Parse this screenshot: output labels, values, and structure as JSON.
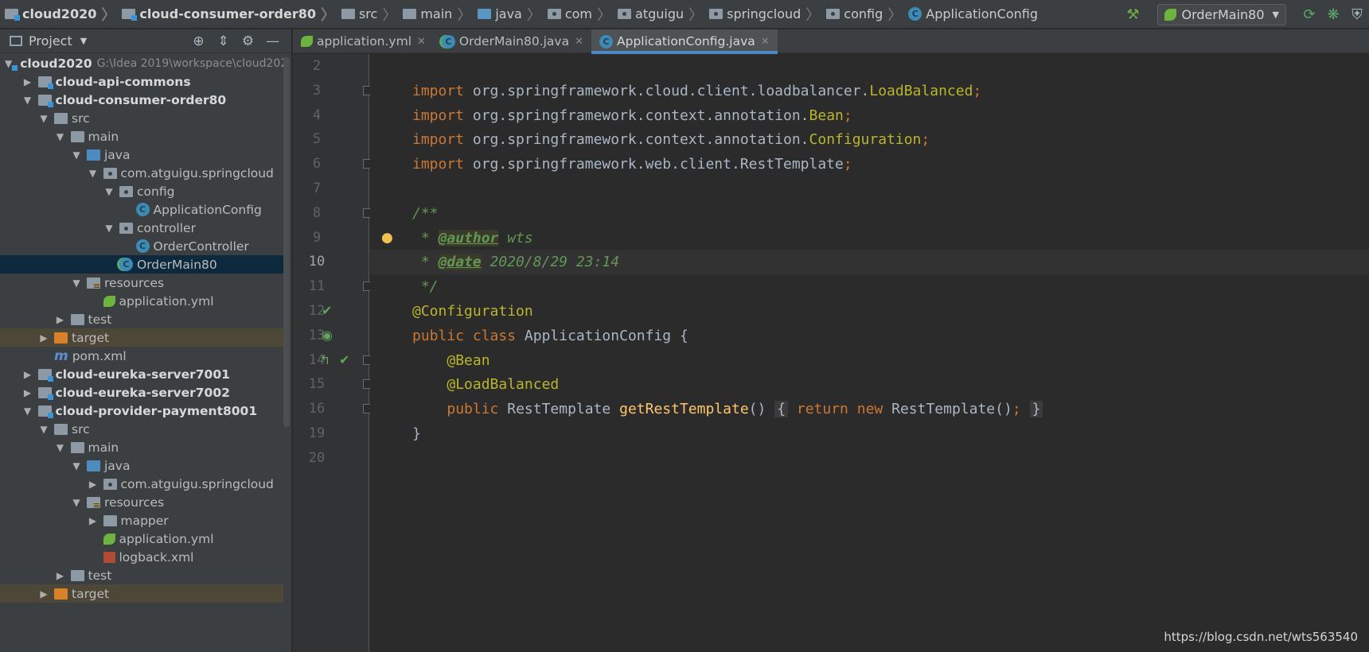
{
  "breadcrumbs": [
    {
      "label": "cloud2020",
      "icon": "module-folder-icon",
      "bold": true
    },
    {
      "label": "cloud-consumer-order80",
      "icon": "module-folder-icon",
      "bold": true
    },
    {
      "label": "src",
      "icon": "folder-icon"
    },
    {
      "label": "main",
      "icon": "folder-icon"
    },
    {
      "label": "java",
      "icon": "source-folder-icon"
    },
    {
      "label": "com",
      "icon": "package-icon"
    },
    {
      "label": "atguigu",
      "icon": "package-icon"
    },
    {
      "label": "springcloud",
      "icon": "package-icon"
    },
    {
      "label": "config",
      "icon": "package-icon"
    },
    {
      "label": "ApplicationConfig",
      "icon": "class-icon"
    }
  ],
  "toolbar": {
    "run_config": "OrderMain80",
    "icons": [
      "build-hammer-icon",
      "rerun-icon",
      "debug-icon",
      "coverage-icon"
    ]
  },
  "project_panel": {
    "title": "Project",
    "icons": [
      "locate-icon",
      "collapse-icon",
      "settings-icon",
      "minimize-icon"
    ]
  },
  "tree": [
    {
      "label": "cloud2020",
      "path": "G:\\Idea 2019\\workspace\\cloud202",
      "depth": 0,
      "expanded": true,
      "icon": "mod",
      "bold": true
    },
    {
      "label": "cloud-api-commons",
      "depth": 1,
      "expanded": false,
      "icon": "mod",
      "bold": true
    },
    {
      "label": "cloud-consumer-order80",
      "depth": 1,
      "expanded": true,
      "icon": "mod",
      "bold": true
    },
    {
      "label": "src",
      "depth": 2,
      "expanded": true,
      "icon": "folder"
    },
    {
      "label": "main",
      "depth": 3,
      "expanded": true,
      "icon": "folder"
    },
    {
      "label": "java",
      "depth": 4,
      "expanded": true,
      "icon": "src"
    },
    {
      "label": "com.atguigu.springcloud",
      "depth": 5,
      "expanded": true,
      "icon": "pkg"
    },
    {
      "label": "config",
      "depth": 6,
      "expanded": true,
      "icon": "pkg"
    },
    {
      "label": "ApplicationConfig",
      "depth": 7,
      "icon": "class"
    },
    {
      "label": "controller",
      "depth": 6,
      "expanded": true,
      "icon": "pkg"
    },
    {
      "label": "OrderController",
      "depth": 7,
      "icon": "class"
    },
    {
      "label": "OrderMain80",
      "depth": 6,
      "icon": "class-run",
      "selected": true
    },
    {
      "label": "resources",
      "depth": 4,
      "expanded": true,
      "icon": "res"
    },
    {
      "label": "application.yml",
      "depth": 5,
      "icon": "yml"
    },
    {
      "label": "test",
      "depth": 3,
      "expanded": false,
      "icon": "folder"
    },
    {
      "label": "target",
      "depth": 2,
      "expanded": false,
      "icon": "target",
      "excluded": true
    },
    {
      "label": "pom.xml",
      "depth": 2,
      "icon": "maven"
    },
    {
      "label": "cloud-eureka-server7001",
      "depth": 1,
      "expanded": false,
      "icon": "mod",
      "bold": true
    },
    {
      "label": "cloud-eureka-server7002",
      "depth": 1,
      "expanded": false,
      "icon": "mod",
      "bold": true
    },
    {
      "label": "cloud-provider-payment8001",
      "depth": 1,
      "expanded": true,
      "icon": "mod",
      "bold": true
    },
    {
      "label": "src",
      "depth": 2,
      "expanded": true,
      "icon": "folder"
    },
    {
      "label": "main",
      "depth": 3,
      "expanded": true,
      "icon": "folder"
    },
    {
      "label": "java",
      "depth": 4,
      "expanded": true,
      "icon": "src"
    },
    {
      "label": "com.atguigu.springcloud",
      "depth": 5,
      "expanded": false,
      "icon": "pkg"
    },
    {
      "label": "resources",
      "depth": 4,
      "expanded": true,
      "icon": "res"
    },
    {
      "label": "mapper",
      "depth": 5,
      "expanded": false,
      "icon": "folder"
    },
    {
      "label": "application.yml",
      "depth": 5,
      "icon": "yml"
    },
    {
      "label": "logback.xml",
      "depth": 5,
      "icon": "xml"
    },
    {
      "label": "test",
      "depth": 3,
      "expanded": false,
      "icon": "folder"
    },
    {
      "label": "target",
      "depth": 2,
      "expanded": false,
      "icon": "target",
      "excluded": true
    }
  ],
  "tabs": [
    {
      "label": "application.yml",
      "icon": "yml",
      "active": false
    },
    {
      "label": "OrderMain80.java",
      "icon": "class-run",
      "active": false
    },
    {
      "label": "ApplicationConfig.java",
      "icon": "class",
      "active": true
    }
  ],
  "editor": {
    "current_line": "10",
    "lines": [
      {
        "num": "2",
        "tokens": []
      },
      {
        "num": "3",
        "fold": true,
        "tokens": [
          {
            "t": "import",
            "c": "kw"
          },
          {
            "t": " org.springframework.cloud.client.loadbalancer.",
            "c": "pl"
          },
          {
            "t": "LoadBalanced",
            "c": "cls"
          },
          {
            "t": ";",
            "c": "kw"
          }
        ]
      },
      {
        "num": "4",
        "tokens": [
          {
            "t": "import",
            "c": "kw"
          },
          {
            "t": " org.springframework.context.annotation.",
            "c": "pl"
          },
          {
            "t": "Bean",
            "c": "cls"
          },
          {
            "t": ";",
            "c": "kw"
          }
        ]
      },
      {
        "num": "5",
        "tokens": [
          {
            "t": "import",
            "c": "kw"
          },
          {
            "t": " org.springframework.context.annotation.",
            "c": "pl"
          },
          {
            "t": "Configuration",
            "c": "cls"
          },
          {
            "t": ";",
            "c": "kw"
          }
        ]
      },
      {
        "num": "6",
        "fold": true,
        "tokens": [
          {
            "t": "import",
            "c": "kw"
          },
          {
            "t": " org.springframework.web.client.RestTemplate",
            "c": "pl"
          },
          {
            "t": ";",
            "c": "kw"
          }
        ]
      },
      {
        "num": "7",
        "tokens": []
      },
      {
        "num": "8",
        "fold": true,
        "tokens": [
          {
            "t": "/**",
            "c": "doc"
          }
        ]
      },
      {
        "num": "9",
        "tokens": [
          {
            "t": " * ",
            "c": "doc"
          },
          {
            "t": "@author",
            "c": "tag"
          },
          {
            "t": " wts",
            "c": "doc"
          }
        ]
      },
      {
        "num": "10",
        "tokens": [
          {
            "t": " * ",
            "c": "doc"
          },
          {
            "t": "@date",
            "c": "tag"
          },
          {
            "t": " 2020/8/29 23:14",
            "c": "doc"
          }
        ]
      },
      {
        "num": "11",
        "fold": true,
        "tokens": [
          {
            "t": " */",
            "c": "doc"
          }
        ]
      },
      {
        "num": "12",
        "marks": [
          "bean-check-icon"
        ],
        "tokens": [
          {
            "t": "@Configuration",
            "c": "ann"
          }
        ]
      },
      {
        "num": "13",
        "marks": [
          "spring-bean-icon"
        ],
        "tokens": [
          {
            "t": "public",
            "c": "kw"
          },
          {
            "t": " ",
            "c": "pl"
          },
          {
            "t": "class",
            "c": "kw"
          },
          {
            "t": " ApplicationConfig {",
            "c": "pl"
          }
        ]
      },
      {
        "num": "14",
        "fold": true,
        "marks": [
          "navigate-icon",
          "bean-check-icon"
        ],
        "tokens": [
          {
            "t": "    ",
            "c": "pl"
          },
          {
            "t": "@Bean",
            "c": "ann"
          }
        ]
      },
      {
        "num": "15",
        "fold": true,
        "tokens": [
          {
            "t": "    ",
            "c": "pl"
          },
          {
            "t": "@LoadBalanced",
            "c": "ann"
          }
        ]
      },
      {
        "num": "16",
        "foldplus": true,
        "tokens": [
          {
            "t": "    ",
            "c": "pl"
          },
          {
            "t": "public",
            "c": "kw"
          },
          {
            "t": " RestTemplate ",
            "c": "pl"
          },
          {
            "t": "getRestTemplate",
            "c": "fn"
          },
          {
            "t": "() ",
            "c": "pl"
          },
          {
            "t": "{",
            "c": "brace"
          },
          {
            "t": " ",
            "c": "pl"
          },
          {
            "t": "return",
            "c": "kw"
          },
          {
            "t": " ",
            "c": "pl"
          },
          {
            "t": "new",
            "c": "kw"
          },
          {
            "t": " RestTemplate()",
            "c": "pl"
          },
          {
            "t": ";",
            "c": "kw"
          },
          {
            "t": " ",
            "c": "pl"
          },
          {
            "t": "}",
            "c": "brace"
          }
        ]
      },
      {
        "num": "19",
        "tokens": [
          {
            "t": "}",
            "c": "pl"
          }
        ]
      },
      {
        "num": "20",
        "tokens": []
      }
    ]
  },
  "watermark": "https://blog.csdn.net/wts563540",
  "colors": {
    "accent": "#4a88c7",
    "keyword": "#cc7832",
    "annotation": "#bbb529",
    "doc": "#629755",
    "function": "#ffc66d"
  }
}
